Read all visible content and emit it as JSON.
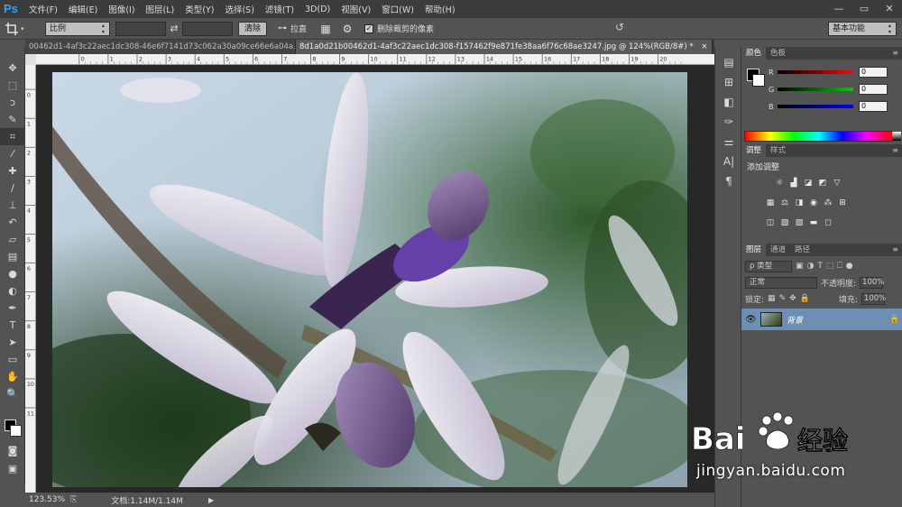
{
  "app": {
    "logo": "Ps",
    "menu": [
      "文件(F)",
      "编辑(E)",
      "图像(I)",
      "图层(L)",
      "类型(Y)",
      "选择(S)",
      "滤镜(T)",
      "3D(D)",
      "视图(V)",
      "窗口(W)",
      "帮助(H)"
    ],
    "window_controls": [
      "—",
      "▭",
      "✕"
    ]
  },
  "options": {
    "crop_mode": "比例",
    "clear_label": "清除",
    "straighten_label": "拉直",
    "delete_cropped_label": "删除裁剪的像素",
    "delete_cropped_checked": true,
    "workspace": "基本功能"
  },
  "documents": {
    "tabs": [
      {
        "label": "00462d1-4af3c22aec1dc308-46e6f7141d73c062a30a09ce66e6a04a.jpg",
        "active": false
      },
      {
        "label": "8d1a0d21b00462d1-4af3c22aec1dc308-f157462f9e871fe38aa6f76c68ae3247.jpg @ 124%(RGB/8#) *",
        "active": true
      }
    ],
    "close_glyph": "×"
  },
  "ruler": {
    "h_ticks": [
      "0",
      "1",
      "2",
      "3",
      "4",
      "5",
      "6",
      "7",
      "8",
      "9",
      "10",
      "11",
      "12",
      "13",
      "14",
      "15",
      "16",
      "17",
      "18",
      "19",
      "20"
    ],
    "v_ticks": [
      "0",
      "1",
      "2",
      "3",
      "4",
      "5",
      "6",
      "7",
      "8",
      "9",
      "10",
      "11"
    ]
  },
  "status": {
    "zoom": "123.53%",
    "doc_info": "文档:1.14M/1.14M"
  },
  "color_panel": {
    "tabs": [
      "颜色",
      "色板"
    ],
    "channels": [
      {
        "label": "R",
        "value": "0",
        "color": "#ff0000"
      },
      {
        "label": "G",
        "value": "0",
        "color": "#00c000"
      },
      {
        "label": "B",
        "value": "0",
        "color": "#0000ff"
      }
    ]
  },
  "adjustments_panel": {
    "tabs": [
      "调整",
      "样式"
    ],
    "title": "添加调整"
  },
  "layers_panel": {
    "tabs": [
      "图层",
      "通道",
      "路径"
    ],
    "filter_kind": "ρ 类型",
    "blend_mode": "正常",
    "opacity_label": "不透明度:",
    "opacity_value": "100%",
    "lock_label": "锁定:",
    "fill_label": "填充:",
    "fill_value": "100%",
    "layers": [
      {
        "name": "背景",
        "locked": true,
        "visible": true
      }
    ]
  },
  "watermark": {
    "text": "jingyan.baidu.com"
  },
  "colors": {
    "menubar_bg": "#3c3c3c",
    "panel_bg": "#535353",
    "layer_selected": "#6d8fb3",
    "ps_blue": "#2fa3f6"
  }
}
